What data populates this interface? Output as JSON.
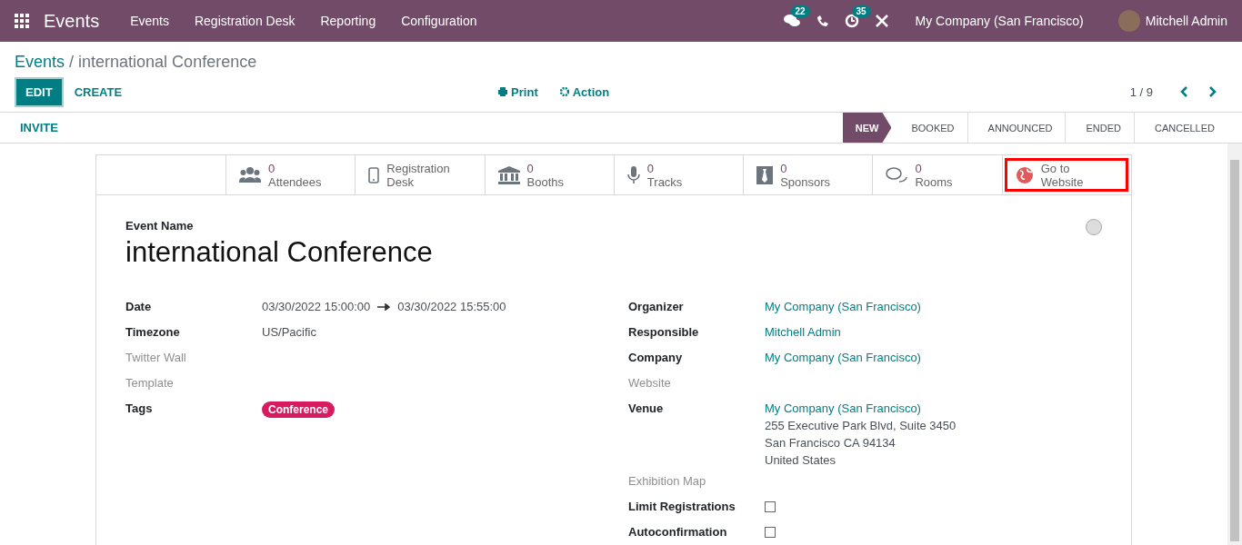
{
  "navbar": {
    "app_name": "Events",
    "menu": [
      "Events",
      "Registration Desk",
      "Reporting",
      "Configuration"
    ],
    "messages_badge": "22",
    "activities_badge": "35",
    "company": "My Company (San Francisco)",
    "user": "Mitchell Admin"
  },
  "breadcrumb": {
    "parent": "Events",
    "separator": "/",
    "current": "international Conference"
  },
  "control_panel": {
    "edit": "EDIT",
    "create": "CREATE",
    "print": "Print",
    "action": "Action",
    "pager": "1 / 9"
  },
  "statusbar": {
    "invite": "INVITE",
    "stages": [
      {
        "label": "NEW",
        "selected": true
      },
      {
        "label": "BOOKED",
        "selected": false
      },
      {
        "label": "ANNOUNCED",
        "selected": false
      },
      {
        "label": "ENDED",
        "selected": false
      },
      {
        "label": "CANCELLED",
        "selected": false
      }
    ]
  },
  "smart_buttons": [
    {
      "kind": "count",
      "count": "0",
      "label": "Attendees",
      "highlighted": false
    },
    {
      "kind": "text",
      "label": "Registration Desk",
      "highlighted": false
    },
    {
      "kind": "count",
      "count": "0",
      "label": "Booths",
      "highlighted": false
    },
    {
      "kind": "count",
      "count": "0",
      "label": "Tracks",
      "highlighted": false
    },
    {
      "kind": "count",
      "count": "0",
      "label": "Sponsors",
      "highlighted": false
    },
    {
      "kind": "count",
      "count": "0",
      "label": "Rooms",
      "highlighted": false
    },
    {
      "kind": "text",
      "label": "Go to Website",
      "highlighted": true
    }
  ],
  "form": {
    "name_label": "Event Name",
    "name": "international Conference",
    "left_fields": [
      {
        "kind": "range",
        "label": "Date",
        "start": "03/30/2022 15:00:00",
        "end": "03/30/2022 15:55:00"
      },
      {
        "kind": "text",
        "label": "Timezone",
        "value": "US/Pacific"
      },
      {
        "kind": "empty",
        "label": "Twitter Wall"
      },
      {
        "kind": "empty",
        "label": "Template"
      },
      {
        "kind": "tag",
        "label": "Tags",
        "value": "Conference",
        "color": "#d81b60"
      }
    ],
    "right_fields": [
      {
        "kind": "link",
        "label": "Organizer",
        "value": "My Company (San Francisco)"
      },
      {
        "kind": "link",
        "label": "Responsible",
        "value": "Mitchell Admin"
      },
      {
        "kind": "link",
        "label": "Company",
        "value": "My Company (San Francisco)"
      },
      {
        "kind": "empty",
        "label": "Website"
      },
      {
        "kind": "address",
        "label": "Venue",
        "value": "My Company (San Francisco)",
        "lines": [
          "255 Executive Park Blvd, Suite 3450",
          "San Francisco CA 94134",
          "United States"
        ]
      },
      {
        "kind": "empty",
        "label": "Exhibition Map"
      },
      {
        "kind": "checkbox",
        "label": "Limit Registrations",
        "checked": false
      },
      {
        "kind": "checkbox",
        "label": "Autoconfirmation",
        "checked": false
      }
    ]
  }
}
